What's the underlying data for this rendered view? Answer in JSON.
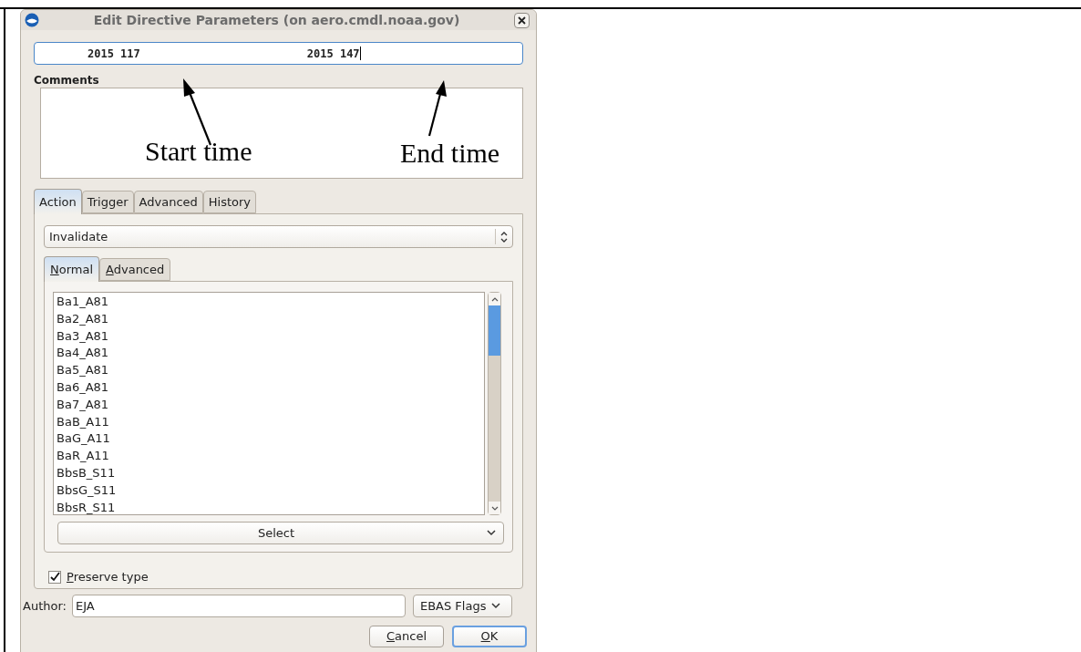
{
  "window": {
    "title": "Edit Directive Parameters (on aero.cmdl.noaa.gov)"
  },
  "time_range": {
    "start": "2015 117",
    "end": "2015 147"
  },
  "comments": {
    "label": "Comments"
  },
  "annotations": [
    {
      "text": "Start time"
    },
    {
      "text": "End time"
    }
  ],
  "tabs": [
    {
      "label": "Action",
      "selected": true
    },
    {
      "label": "Trigger",
      "selected": false
    },
    {
      "label": "Advanced",
      "selected": false
    },
    {
      "label": "History",
      "selected": false
    }
  ],
  "action": {
    "value": "Invalidate"
  },
  "subtabs": [
    {
      "label": "Normal",
      "selected": true,
      "mnemonic": true
    },
    {
      "label": "Advanced",
      "selected": false,
      "mnemonic": true
    }
  ],
  "variables": [
    "Ba1_A81",
    "Ba2_A81",
    "Ba3_A81",
    "Ba4_A81",
    "Ba5_A81",
    "Ba6_A81",
    "Ba7_A81",
    "BaB_A11",
    "BaG_A11",
    "BaR_A11",
    "BbsB_S11",
    "BbsG_S11",
    "BbsR_S11"
  ],
  "select": {
    "label": "Select"
  },
  "preserve_type": {
    "label": "Preserve type",
    "checked": true,
    "mnemonic": true
  },
  "author": {
    "label": "Author:",
    "value": "EJA"
  },
  "flag_format": {
    "value": "EBAS Flags"
  },
  "buttons": [
    {
      "label": "Cancel",
      "mnemonic": true,
      "default": false
    },
    {
      "label": "OK",
      "mnemonic": true,
      "default": true
    }
  ]
}
